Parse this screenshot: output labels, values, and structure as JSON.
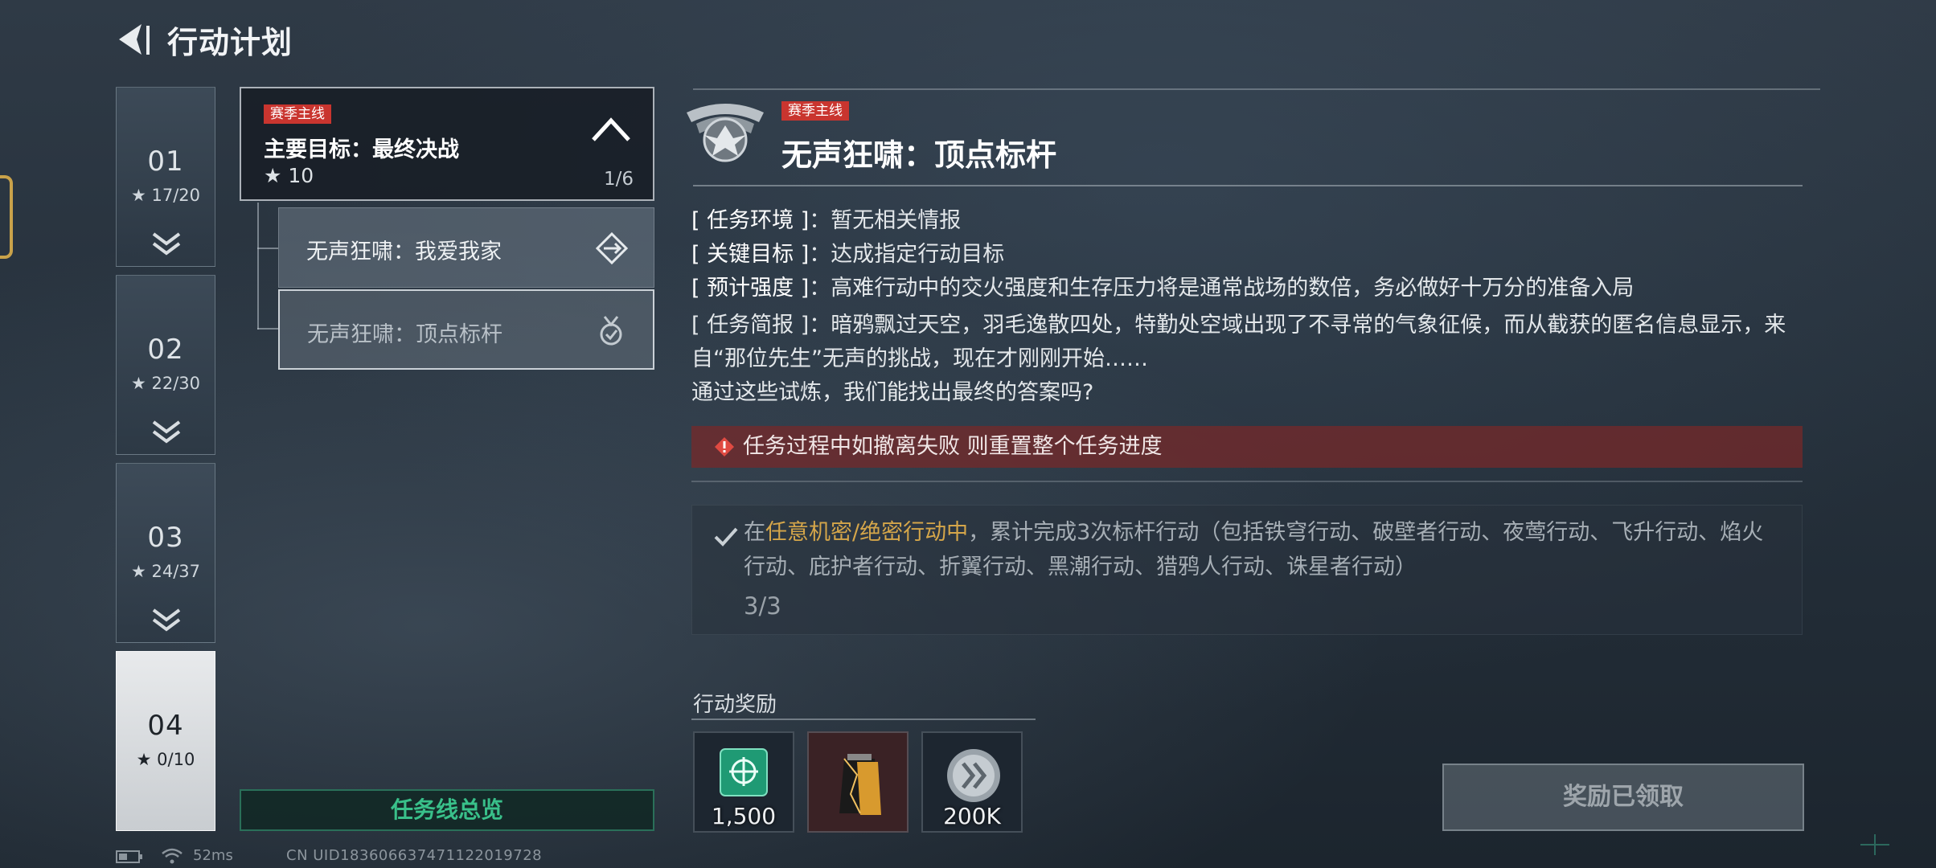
{
  "header": {
    "title": "行动计划"
  },
  "chapters": [
    {
      "num": "01",
      "stars": "17/20",
      "active": false
    },
    {
      "num": "02",
      "stars": "22/30",
      "active": false
    },
    {
      "num": "03",
      "stars": "24/37",
      "active": false
    },
    {
      "num": "04",
      "stars": "0/10",
      "active": true
    }
  ],
  "mission_tree": {
    "main": {
      "tag": "赛季主线",
      "title": "主要目标：最终决战",
      "stars": "10",
      "progress": "1/6"
    },
    "subs": [
      {
        "title": "无声狂啸：我爱我家",
        "icon": "diamond-arrow-icon",
        "selected": false
      },
      {
        "title": "无声狂啸：顶点标杆",
        "icon": "medal-check-icon",
        "selected": true
      }
    ],
    "overview_button": "任务线总览"
  },
  "detail": {
    "tag": "赛季主线",
    "title": "无声狂啸：顶点标杆",
    "emblem": "eagle-emblem-icon",
    "info": [
      {
        "key": "[ 任务环境 ]",
        "value": "：暂无相关情报"
      },
      {
        "key": "[ 关键目标 ]",
        "value": "：达成指定行动目标"
      },
      {
        "key": "[ 预计强度 ]",
        "value": "：高难行动中的交火强度和生存压力将是通常战场的数倍，务必做好十万分的准备入局"
      }
    ],
    "brief_key": "[ 任务简报 ]",
    "brief_value": "：暗鸦飘过天空，羽毛逸散四处，特勤处空域出现了不寻常的气象征候，而从截获的匿名信息显示，来自“那位先生”无声的挑战，现在才刚刚开始……",
    "brief_question": "通过这些试炼，我们能找出最终的答案吗?",
    "warning": "任务过程中如撤离失败 则重置整个任务进度",
    "objective": {
      "prefix": "在",
      "highlight": "任意机密/绝密行动中",
      "text": "，累计完成3次标杆行动（包括铁穹行动、破壁者行动、夜莺行动、飞升行动、焰火行动、庇护者行动、折翼行动、黑潮行动、猎鸦人行动、诛星者行动）",
      "count": "3/3"
    }
  },
  "rewards": {
    "label": "行动奖励",
    "items": [
      {
        "name": "green-emblem-item-icon",
        "amount": "1,500"
      },
      {
        "name": "gold-pouch-item-icon",
        "amount": ""
      },
      {
        "name": "silver-coin-item-icon",
        "amount": "200K"
      }
    ],
    "claim_button": "奖励已领取"
  },
  "footer": {
    "ping": "52ms",
    "uid": "CN UID18360663747112201972­8"
  },
  "colors": {
    "tag_red": "#c9352f",
    "accent_green": "#39c08a",
    "highlight_gold": "#d5a64a"
  }
}
